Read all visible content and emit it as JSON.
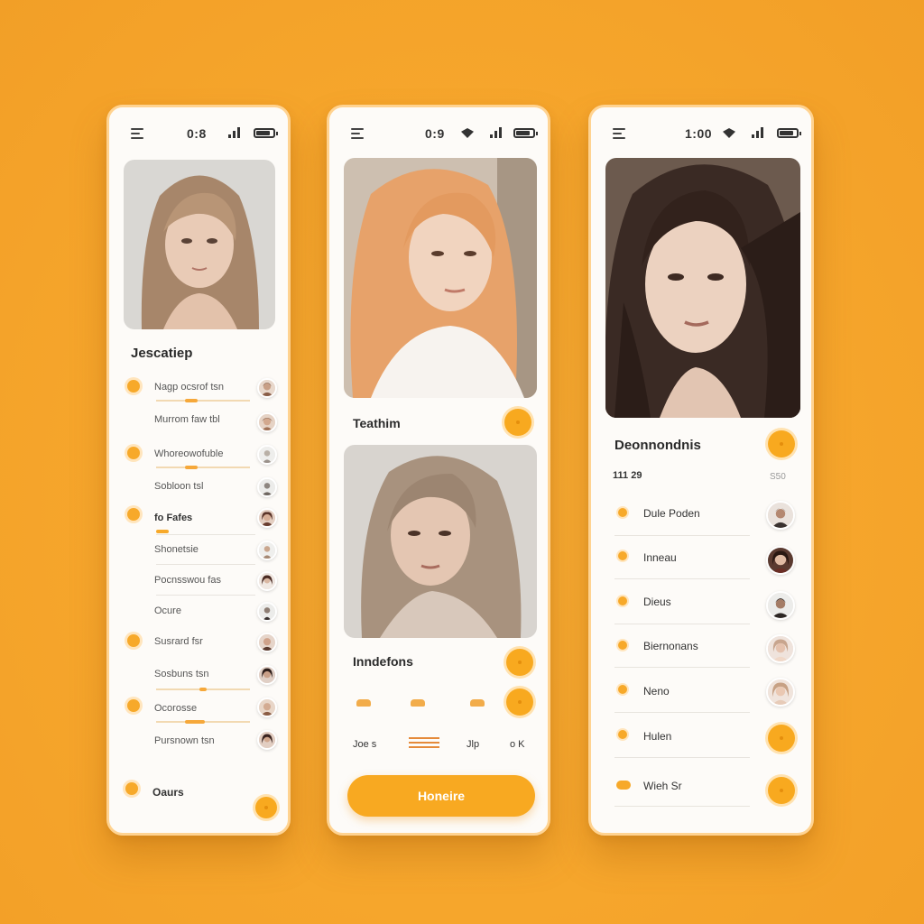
{
  "colors": {
    "accent": "#f8a91f",
    "background": "#f6a62c",
    "card": "#fdfbf8"
  },
  "phone1": {
    "status": {
      "time": "0:8",
      "menu_icon": "menu-icon",
      "signal_icon": "signal-icon",
      "battery_icon": "battery-icon"
    },
    "heading": "Jescatiep",
    "items": [
      {
        "label": "Nagp ocsrof tsn"
      },
      {
        "label": "Murrom faw tbl"
      },
      {
        "label": "Whoreowofuble"
      },
      {
        "label": "Sobloon tsl"
      },
      {
        "label": "fo Fafes"
      },
      {
        "label": "Shonetsie"
      },
      {
        "label": "Pocnsswou fas"
      },
      {
        "label": "Ocure"
      },
      {
        "label": "Susrard fsr"
      },
      {
        "label": "Sosbuns tsn"
      },
      {
        "label": "Ocorosse"
      },
      {
        "label": "Pursnown tsn"
      }
    ],
    "footer_label": "Oaurs"
  },
  "phone2": {
    "status": {
      "time": "0:9",
      "menu_icon": "menu-icon",
      "wifi_icon": "wifi-icon",
      "signal_icon": "signal-icon",
      "battery_icon": "battery-icon"
    },
    "card1_title": "Teathim",
    "card2_title": "Inndefons",
    "tabs": [
      "Joe s",
      "Jlp",
      "o K"
    ],
    "cta_label": "Honeire"
  },
  "phone3": {
    "status": {
      "time": "1:00",
      "menu_icon": "menu-icon",
      "wifi_icon": "wifi-icon",
      "signal_icon": "signal-icon",
      "battery_icon": "battery-icon"
    },
    "heading": "Deonnondnis",
    "stats_left": "111 29",
    "stats_right": "S50",
    "items": [
      {
        "label": "Dule Poden"
      },
      {
        "label": "Inneau"
      },
      {
        "label": "Dieus"
      },
      {
        "label": "Biernonans"
      },
      {
        "label": "Neno"
      },
      {
        "label": "Hulen"
      },
      {
        "label": "Wieh Sr"
      }
    ]
  }
}
